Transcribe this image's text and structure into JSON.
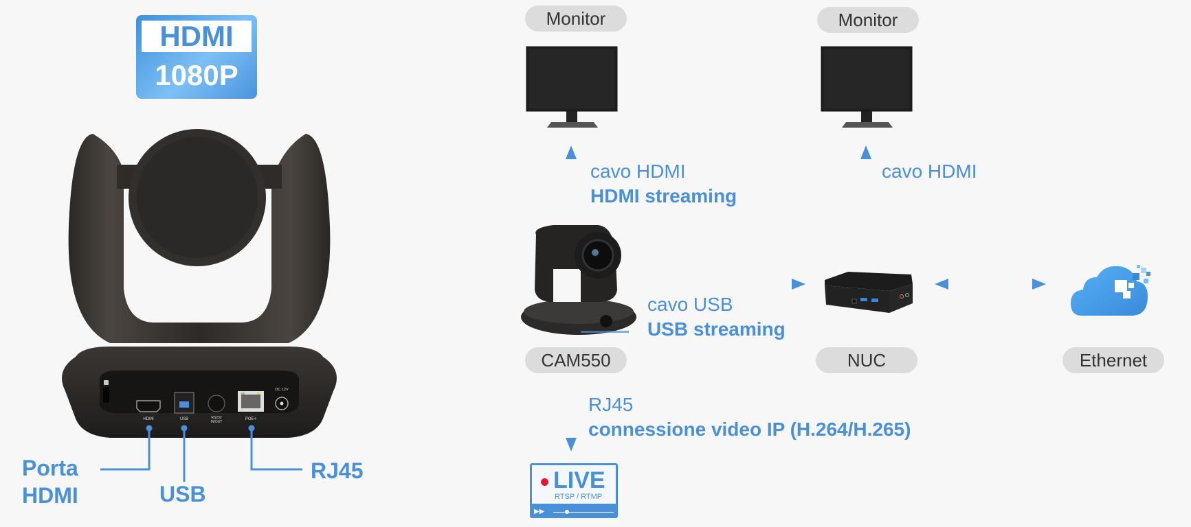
{
  "hdmi_badge": {
    "top": "HDMI",
    "bottom": "1080P"
  },
  "camera_rear": {
    "ports": [
      {
        "name": "lock",
        "label": ""
      },
      {
        "name": "hdmi",
        "label": "HDMI"
      },
      {
        "name": "usb",
        "label": "USB"
      },
      {
        "name": "rs232",
        "label": "RS232 IN/OUT"
      },
      {
        "name": "poe",
        "label": "POE+"
      },
      {
        "name": "dc",
        "label": "DC 12V"
      }
    ]
  },
  "callouts": {
    "hdmi_line1": "Porta",
    "hdmi_line2": "HDMI",
    "usb": "USB",
    "rj45": "RJ45"
  },
  "nodes": {
    "monitor_left": "Monitor",
    "monitor_right": "Monitor",
    "camera": "CAM550",
    "nuc": "NUC",
    "ethernet": "Ethernet"
  },
  "connections": {
    "hdmi_cam": {
      "line1": "cavo HDMI",
      "line2": "HDMI streaming"
    },
    "hdmi_nuc": {
      "line1": "cavo HDMI"
    },
    "usb": {
      "line1": "cavo USB",
      "line2": "USB streaming"
    },
    "rj45": {
      "line1": "RJ45",
      "line2": "connessione video IP (H.264/H.265)"
    }
  },
  "live_badge": {
    "title": "LIVE",
    "subtitle": "RTSP / RTMP"
  },
  "colors": {
    "accent": "#4a90d9",
    "pill_bg": "#dcdcdc",
    "device": "#262626",
    "live_dot": "#e0192e"
  }
}
